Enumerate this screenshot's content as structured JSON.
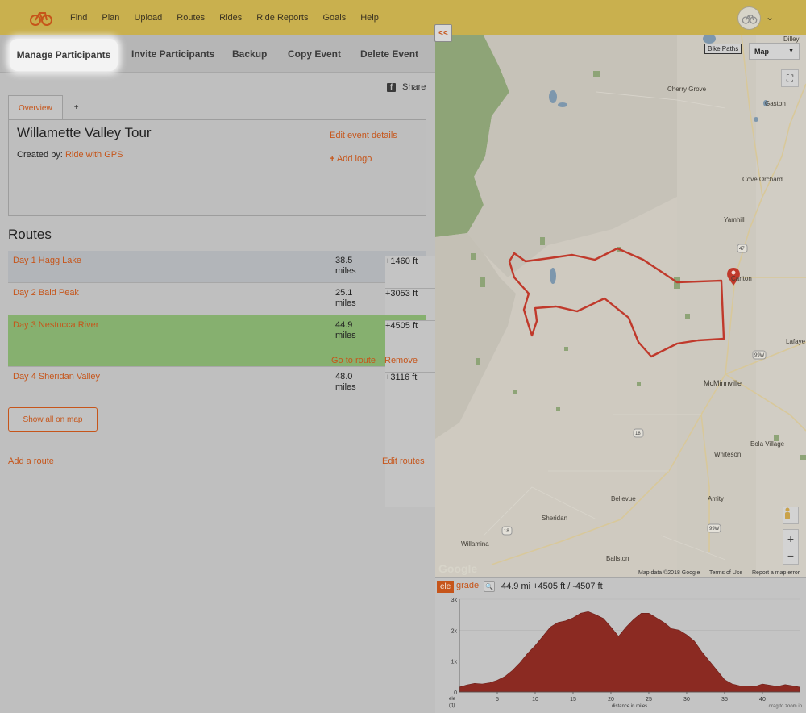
{
  "topnav": {
    "links": [
      "Find",
      "Plan",
      "Upload",
      "Routes",
      "Rides",
      "Ride Reports",
      "Goals",
      "Help"
    ],
    "logo_icon": "bicycle-icon",
    "avatar_icon": "user-avatar-icon"
  },
  "toolbar": {
    "tabs": [
      "Manage Participants",
      "Invite Participants",
      "Backup",
      "Copy Event",
      "Delete Event"
    ],
    "active": "Manage Participants",
    "collapse_label": "<<"
  },
  "share": {
    "label": "Share",
    "icon": "facebook-icon"
  },
  "overview": {
    "tabs": [
      "Overview",
      "+"
    ],
    "title": "Willamette Valley Tour",
    "created_by_label": "Created by:",
    "created_by_value": "Ride with GPS",
    "edit_details": "Edit event details",
    "add_logo": "Add logo"
  },
  "routes": {
    "heading": "Routes",
    "items": [
      {
        "name": "Day 1 Hagg Lake",
        "distance": "38.5",
        "unit": "miles",
        "elevation": "+1460 ft"
      },
      {
        "name": "Day 2 Bald Peak",
        "distance": "25.1",
        "unit": "miles",
        "elevation": "+3053 ft"
      },
      {
        "name": "Day 3 Nestucca River",
        "distance": "44.9",
        "unit": "miles",
        "elevation": "+4505 ft",
        "selected": true
      },
      {
        "name": "Day 4 Sheridan Valley",
        "distance": "48.0",
        "unit": "miles",
        "elevation": "+3116 ft"
      }
    ],
    "go_to_route": "Go to route",
    "remove": "Remove",
    "show_all": "Show all on map",
    "add_route": "Add a route",
    "edit_routes": "Edit routes"
  },
  "map": {
    "bike_paths": "Bike Paths",
    "map_type": "Map",
    "labels": [
      "Cherry Grove",
      "Gaston",
      "Dilley",
      "Cove Orchard",
      "Yamhill",
      "Carlton",
      "Lafaye",
      "McMinnville",
      "Eola Village",
      "Whiteson",
      "Bellevue",
      "Amity",
      "Sheridan",
      "Willamina",
      "Ballston"
    ],
    "road_shields": [
      "47",
      "47",
      "99W",
      "99W",
      "18",
      "18"
    ],
    "google": "Google",
    "attribution": [
      "Map data ©2018 Google",
      "Terms of Use",
      "Report a map error"
    ],
    "route_color": "#c0392b"
  },
  "elevation": {
    "ele_label": "ele",
    "grade_label": "grade",
    "stats": "44.9 mi +4505 ft / -4507 ft",
    "y_unit": "ele (ft)",
    "x_label": "distance in miles",
    "hint": "drag to zoom in",
    "fill_color": "#8b2a22"
  },
  "chart_data": {
    "type": "area",
    "xlabel": "distance in miles",
    "ylabel": "ele (ft)",
    "xlim": [
      0,
      44.9
    ],
    "ylim": [
      0,
      3000
    ],
    "x_ticks": [
      5,
      10,
      15,
      20,
      25,
      30,
      35,
      40
    ],
    "y_ticks": [
      "0",
      "1k",
      "2k",
      "3k"
    ],
    "series": [
      {
        "x": [
          0,
          1,
          2,
          3,
          4,
          5,
          6,
          7,
          8,
          9,
          10,
          11,
          12,
          13,
          14,
          15,
          16,
          17,
          18,
          19,
          20,
          21,
          22,
          23,
          24,
          25,
          26,
          27,
          28,
          29,
          30,
          31,
          32,
          33,
          34,
          35,
          36,
          37,
          38,
          39,
          40,
          41,
          42,
          43,
          44,
          44.9
        ],
        "y": [
          160,
          230,
          280,
          260,
          300,
          380,
          500,
          700,
          950,
          1250,
          1500,
          1800,
          2100,
          2250,
          2300,
          2400,
          2550,
          2600,
          2500,
          2380,
          2100,
          1800,
          2100,
          2350,
          2550,
          2550,
          2400,
          2250,
          2050,
          2000,
          1850,
          1650,
          1300,
          1000,
          700,
          400,
          260,
          200,
          190,
          180,
          260,
          220,
          180,
          240,
          200,
          160
        ]
      }
    ]
  }
}
